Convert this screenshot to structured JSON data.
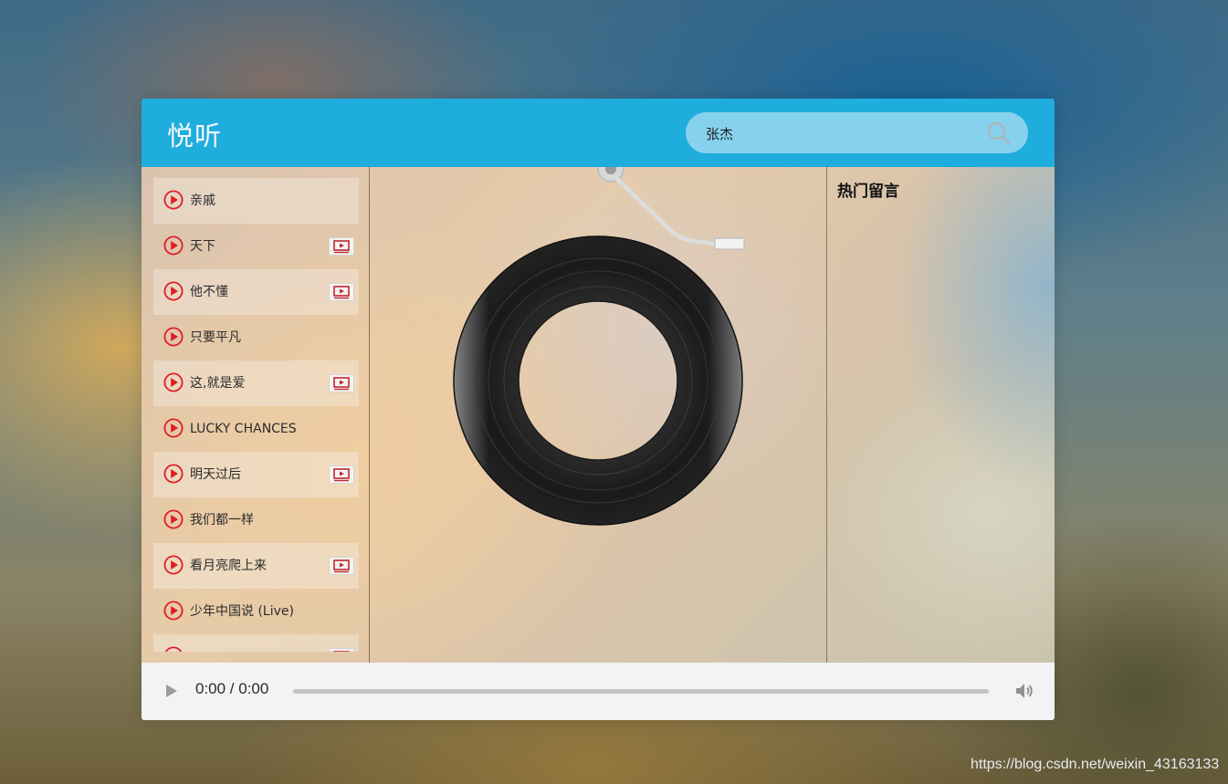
{
  "app": {
    "logo": "悦听",
    "search": {
      "value": "张杰",
      "icon": "search-icon"
    }
  },
  "playlist": [
    {
      "title": "亲戚",
      "has_mv": false,
      "icon": "play-circle-icon"
    },
    {
      "title": "天下",
      "has_mv": true,
      "icon": "play-circle-icon"
    },
    {
      "title": "他不懂",
      "has_mv": true,
      "icon": "play-circle-icon"
    },
    {
      "title": "只要平凡",
      "has_mv": false,
      "icon": "play-circle-icon"
    },
    {
      "title": "这,就是爱",
      "has_mv": true,
      "icon": "play-circle-icon"
    },
    {
      "title": "LUCKY CHANCES",
      "has_mv": false,
      "icon": "play-circle-icon"
    },
    {
      "title": "明天过后",
      "has_mv": true,
      "icon": "play-circle-icon"
    },
    {
      "title": "我们都一样",
      "has_mv": false,
      "icon": "play-circle-icon"
    },
    {
      "title": "看月亮爬上来",
      "has_mv": true,
      "icon": "play-circle-icon"
    },
    {
      "title": "少年中国说 (Live)",
      "has_mv": false,
      "icon": "play-circle-icon"
    },
    {
      "title": "",
      "has_mv": true,
      "icon": "play-circle-icon"
    }
  ],
  "comments": {
    "title": "热门留言"
  },
  "player": {
    "time": "0:00 / 0:00",
    "progress": 0,
    "play_icon": "play-icon",
    "volume_icon": "volume-icon"
  },
  "colors": {
    "header": "#1fadde",
    "search_bg": "#86d2ee",
    "play_icon": "#e21c24",
    "player_bar": "#f1f3f4"
  },
  "watermark": "https://blog.csdn.net/weixin_43163133"
}
